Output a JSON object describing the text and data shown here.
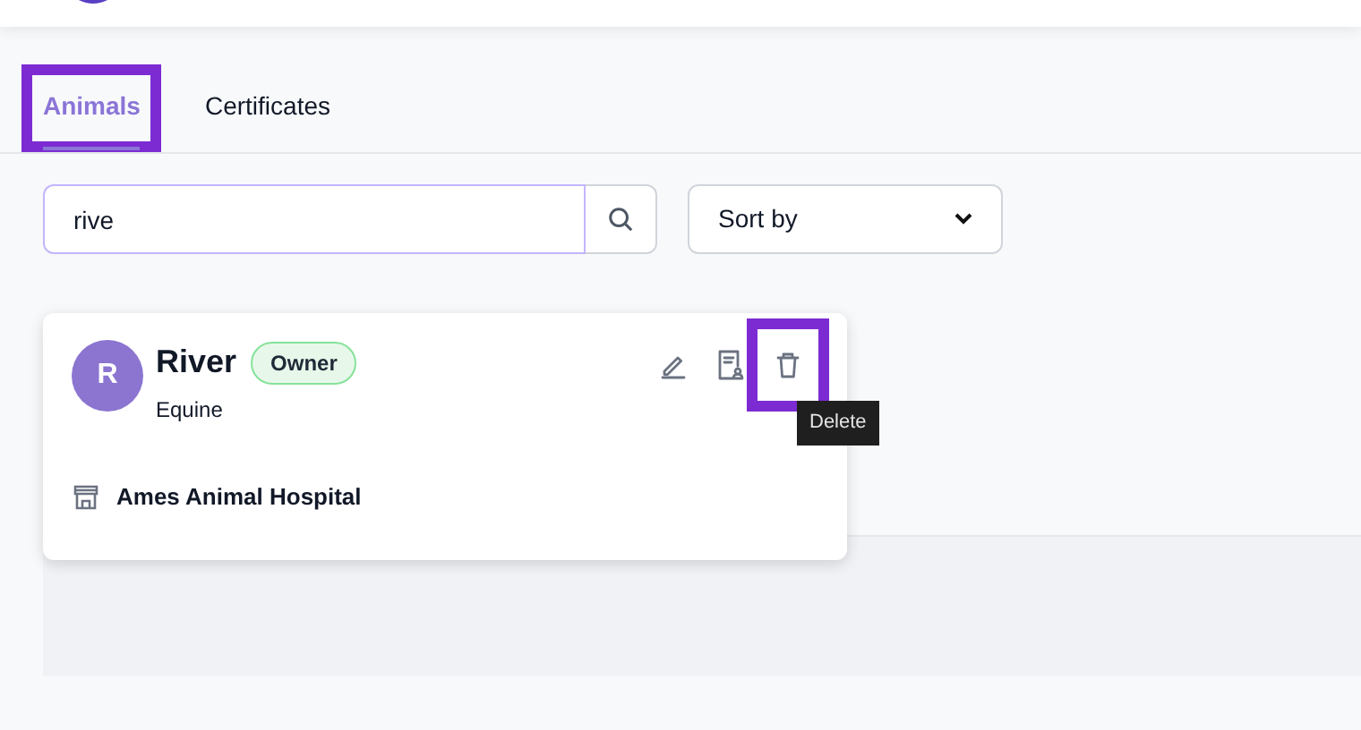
{
  "tabs": [
    {
      "label": "Animals",
      "selected": true,
      "highlighted": true
    },
    {
      "label": "Certificates",
      "selected": false,
      "highlighted": false
    }
  ],
  "search": {
    "value": "rive"
  },
  "sort": {
    "value": "Sort by"
  },
  "animal_card": {
    "initial": "R",
    "name": "River",
    "badge": "Owner",
    "species": "Equine",
    "clinic": "Ames Animal Hospital",
    "actions": [
      {
        "kind": "edit",
        "highlighted": false
      },
      {
        "kind": "certificate",
        "highlighted": false
      },
      {
        "kind": "delete",
        "highlighted": true,
        "tooltip": "Delete"
      }
    ]
  }
}
